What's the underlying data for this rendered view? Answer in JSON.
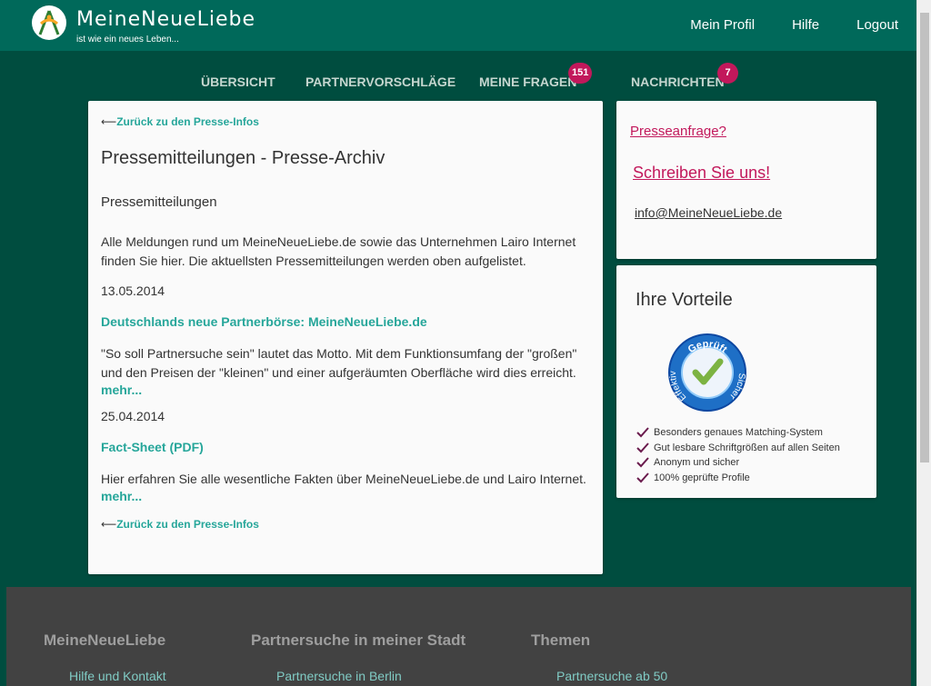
{
  "header": {
    "brand_name": "MeineNeueLiebe",
    "tagline": "ist wie ein neues Leben...",
    "nav": [
      "Mein Profil",
      "Hilfe",
      "Logout"
    ]
  },
  "main_nav": {
    "items": [
      {
        "label": "ÜBERSICHT"
      },
      {
        "label": "PARTNERVORSCHLÄGE"
      },
      {
        "label": "MEINE FRAGEN",
        "badge": "151"
      },
      {
        "label": "NACHRICHTEN",
        "badge": "7"
      }
    ]
  },
  "content": {
    "back_link": "Zurück zu den Presse-Infos",
    "title": "Pressemitteilungen - Presse-Archiv",
    "subheading": "Pressemitteilungen",
    "intro": "Alle Meldungen rund um MeineNeueLiebe.de sowie das Unternehmen Lairo Internet finden Sie hier. Die aktuellsten Pressemitteilungen werden oben aufgelistet.",
    "releases": [
      {
        "date": "13.05.2014",
        "title": "Deutschlands neue Partnerbörse: MeineNeueLiebe.de",
        "text": "\"So soll Partnersuche sein\" lautet das Motto. Mit dem Funktionsumfang der \"großen\" und den Preisen der \"kleinen\" und einer aufgeräumten Oberfläche wird dies erreicht.",
        "more": "mehr..."
      },
      {
        "date": "25.04.2014",
        "title": "Fact-Sheet (PDF)",
        "text": "Hier erfahren Sie alle wesentliche Fakten über MeineNeueLiebe.de und Lairo Internet.",
        "more": "mehr..."
      }
    ]
  },
  "press_card": {
    "question": "Presseanfrage?",
    "write_us": "Schreiben Sie uns!",
    "email": "info@MeineNeueLiebe.de"
  },
  "advantages": {
    "title": "Ihre Vorteile",
    "seal": {
      "top": "Geprüft",
      "left": "Effektiv",
      "right": "Sicher"
    },
    "features": [
      "Besonders genaues Matching-System",
      "Gut lesbare Schriftgrößen auf allen Seiten",
      "Anonym und sicher",
      "100% geprüfte Profile"
    ]
  },
  "footer": {
    "columns": [
      {
        "title": "MeineNeueLiebe",
        "link": "Hilfe und Kontakt"
      },
      {
        "title": "Partnersuche in meiner Stadt",
        "link": "Partnersuche in Berlin"
      },
      {
        "title": "Themen",
        "link": "Partnersuche ab 50"
      }
    ]
  },
  "colors": {
    "header_bg": "#00695a",
    "page_bg": "#004d3f",
    "accent_teal": "#26a69a",
    "accent_pink": "#c2185b",
    "footer_bg": "#424242"
  }
}
